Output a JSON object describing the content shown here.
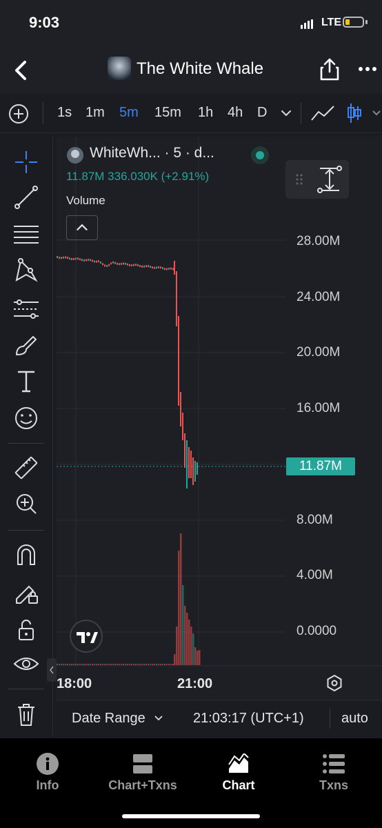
{
  "status_bar": {
    "time": "9:03",
    "network": "LTE"
  },
  "header": {
    "title": "The White Whale",
    "back_icon": "chevron-left-icon",
    "share_icon": "share-icon",
    "more_icon": "ellipsis-icon"
  },
  "toolbar": {
    "intervals": [
      "1s",
      "1m",
      "5m",
      "15m",
      "1h",
      "4h",
      "D"
    ],
    "active_interval": "5m",
    "accent": "#3b82f6"
  },
  "legend": {
    "symbol": "WhiteWh... · 5 · d...",
    "values": "11.87M  336.030K (+2.91%)",
    "volume_label": "Volume"
  },
  "y_axis": {
    "labels": [
      "28.00M",
      "24.00M",
      "20.00M",
      "16.00M",
      "8.00M",
      "4.00M",
      "0.0000"
    ],
    "current_price": "11.87M"
  },
  "x_axis": {
    "labels": [
      "18:00",
      "21:00"
    ]
  },
  "date_bar": {
    "range_label": "Date Range",
    "clock": "21:03:17 (UTC+1)",
    "scale_label": "auto"
  },
  "bottom_nav": [
    {
      "label": "Info",
      "icon": "info-icon"
    },
    {
      "label": "Chart+Txns",
      "icon": "split-view-icon"
    },
    {
      "label": "Chart",
      "icon": "area-chart-icon"
    },
    {
      "label": "Txns",
      "icon": "list-icon"
    }
  ],
  "colors": {
    "up": "#26a69a",
    "down": "#ef5350",
    "background": "#1e1f25"
  }
}
